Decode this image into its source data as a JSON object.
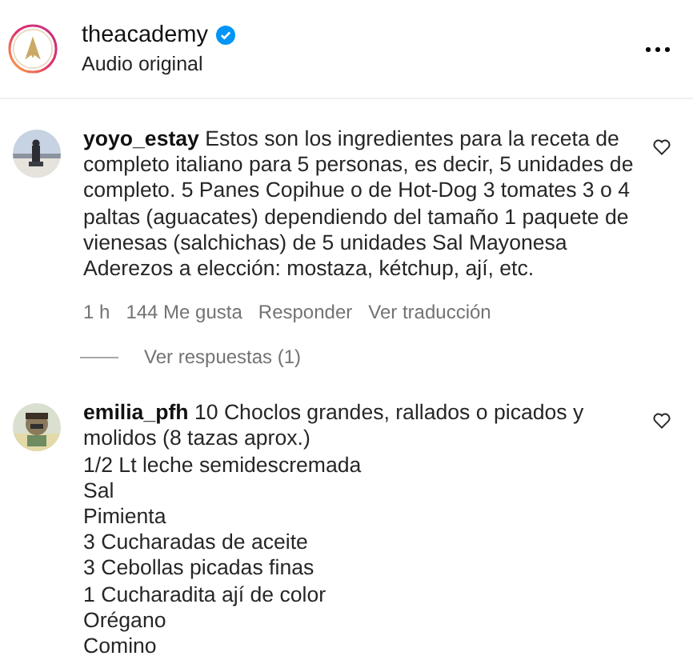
{
  "post_header": {
    "username": "theacademy",
    "verified": true,
    "subtitle": "Audio original"
  },
  "comments": [
    {
      "username": "yoyo_estay",
      "text": "Estos son los ingredientes para la receta de completo italiano para 5 personas, es decir, 5 unidades de completo. 5 Panes Copihue o de Hot-Dog 3 tomates 3 o 4 paltas (aguacates) dependiendo del tamaño 1 paquete de vienesas (salchichas) de 5 unidades Sal Mayonesa Aderezos a elección: mostaza, kétchup, ají, etc.",
      "time": "1 h",
      "likes": "144 Me gusta",
      "reply": "Responder",
      "translate": "Ver traducción",
      "replies": "Ver respuestas (1)",
      "liked": false
    },
    {
      "username": "emilia_pfh",
      "text": "10 Choclos grandes, rallados o picados y molidos (8 tazas aprox.)\n1/2 Lt leche semidescremada\nSal\nPimienta\n3 Cucharadas de aceite\n3 Cebollas picadas finas\n1 Cucharadita ají de color\nOrégano\nComino",
      "liked": false
    }
  ]
}
